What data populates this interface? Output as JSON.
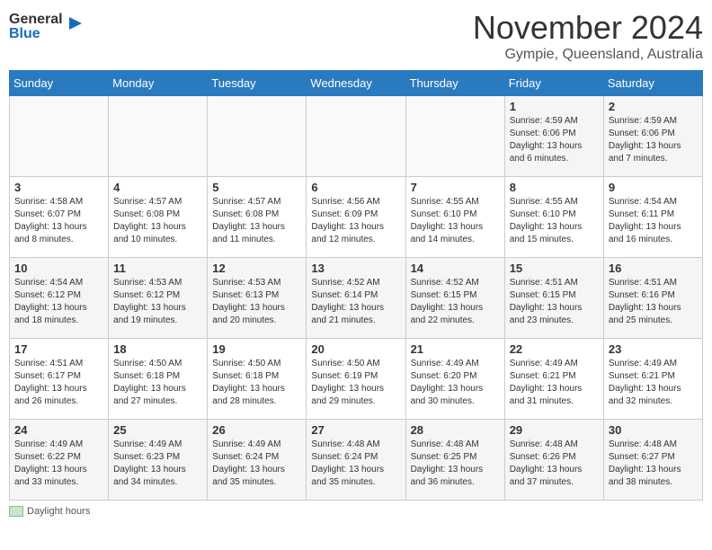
{
  "header": {
    "logo_line1": "General",
    "logo_line2": "Blue",
    "month": "November 2024",
    "location": "Gympie, Queensland, Australia"
  },
  "days_of_week": [
    "Sunday",
    "Monday",
    "Tuesday",
    "Wednesday",
    "Thursday",
    "Friday",
    "Saturday"
  ],
  "weeks": [
    [
      {
        "day": "",
        "info": ""
      },
      {
        "day": "",
        "info": ""
      },
      {
        "day": "",
        "info": ""
      },
      {
        "day": "",
        "info": ""
      },
      {
        "day": "",
        "info": ""
      },
      {
        "day": "1",
        "info": "Sunrise: 4:59 AM\nSunset: 6:06 PM\nDaylight: 13 hours\nand 6 minutes."
      },
      {
        "day": "2",
        "info": "Sunrise: 4:59 AM\nSunset: 6:06 PM\nDaylight: 13 hours\nand 7 minutes."
      }
    ],
    [
      {
        "day": "3",
        "info": "Sunrise: 4:58 AM\nSunset: 6:07 PM\nDaylight: 13 hours\nand 8 minutes."
      },
      {
        "day": "4",
        "info": "Sunrise: 4:57 AM\nSunset: 6:08 PM\nDaylight: 13 hours\nand 10 minutes."
      },
      {
        "day": "5",
        "info": "Sunrise: 4:57 AM\nSunset: 6:08 PM\nDaylight: 13 hours\nand 11 minutes."
      },
      {
        "day": "6",
        "info": "Sunrise: 4:56 AM\nSunset: 6:09 PM\nDaylight: 13 hours\nand 12 minutes."
      },
      {
        "day": "7",
        "info": "Sunrise: 4:55 AM\nSunset: 6:10 PM\nDaylight: 13 hours\nand 14 minutes."
      },
      {
        "day": "8",
        "info": "Sunrise: 4:55 AM\nSunset: 6:10 PM\nDaylight: 13 hours\nand 15 minutes."
      },
      {
        "day": "9",
        "info": "Sunrise: 4:54 AM\nSunset: 6:11 PM\nDaylight: 13 hours\nand 16 minutes."
      }
    ],
    [
      {
        "day": "10",
        "info": "Sunrise: 4:54 AM\nSunset: 6:12 PM\nDaylight: 13 hours\nand 18 minutes."
      },
      {
        "day": "11",
        "info": "Sunrise: 4:53 AM\nSunset: 6:12 PM\nDaylight: 13 hours\nand 19 minutes."
      },
      {
        "day": "12",
        "info": "Sunrise: 4:53 AM\nSunset: 6:13 PM\nDaylight: 13 hours\nand 20 minutes."
      },
      {
        "day": "13",
        "info": "Sunrise: 4:52 AM\nSunset: 6:14 PM\nDaylight: 13 hours\nand 21 minutes."
      },
      {
        "day": "14",
        "info": "Sunrise: 4:52 AM\nSunset: 6:15 PM\nDaylight: 13 hours\nand 22 minutes."
      },
      {
        "day": "15",
        "info": "Sunrise: 4:51 AM\nSunset: 6:15 PM\nDaylight: 13 hours\nand 23 minutes."
      },
      {
        "day": "16",
        "info": "Sunrise: 4:51 AM\nSunset: 6:16 PM\nDaylight: 13 hours\nand 25 minutes."
      }
    ],
    [
      {
        "day": "17",
        "info": "Sunrise: 4:51 AM\nSunset: 6:17 PM\nDaylight: 13 hours\nand 26 minutes."
      },
      {
        "day": "18",
        "info": "Sunrise: 4:50 AM\nSunset: 6:18 PM\nDaylight: 13 hours\nand 27 minutes."
      },
      {
        "day": "19",
        "info": "Sunrise: 4:50 AM\nSunset: 6:18 PM\nDaylight: 13 hours\nand 28 minutes."
      },
      {
        "day": "20",
        "info": "Sunrise: 4:50 AM\nSunset: 6:19 PM\nDaylight: 13 hours\nand 29 minutes."
      },
      {
        "day": "21",
        "info": "Sunrise: 4:49 AM\nSunset: 6:20 PM\nDaylight: 13 hours\nand 30 minutes."
      },
      {
        "day": "22",
        "info": "Sunrise: 4:49 AM\nSunset: 6:21 PM\nDaylight: 13 hours\nand 31 minutes."
      },
      {
        "day": "23",
        "info": "Sunrise: 4:49 AM\nSunset: 6:21 PM\nDaylight: 13 hours\nand 32 minutes."
      }
    ],
    [
      {
        "day": "24",
        "info": "Sunrise: 4:49 AM\nSunset: 6:22 PM\nDaylight: 13 hours\nand 33 minutes."
      },
      {
        "day": "25",
        "info": "Sunrise: 4:49 AM\nSunset: 6:23 PM\nDaylight: 13 hours\nand 34 minutes."
      },
      {
        "day": "26",
        "info": "Sunrise: 4:49 AM\nSunset: 6:24 PM\nDaylight: 13 hours\nand 35 minutes."
      },
      {
        "day": "27",
        "info": "Sunrise: 4:48 AM\nSunset: 6:24 PM\nDaylight: 13 hours\nand 35 minutes."
      },
      {
        "day": "28",
        "info": "Sunrise: 4:48 AM\nSunset: 6:25 PM\nDaylight: 13 hours\nand 36 minutes."
      },
      {
        "day": "29",
        "info": "Sunrise: 4:48 AM\nSunset: 6:26 PM\nDaylight: 13 hours\nand 37 minutes."
      },
      {
        "day": "30",
        "info": "Sunrise: 4:48 AM\nSunset: 6:27 PM\nDaylight: 13 hours\nand 38 minutes."
      }
    ]
  ],
  "footer": {
    "legend_label": "Daylight hours"
  }
}
